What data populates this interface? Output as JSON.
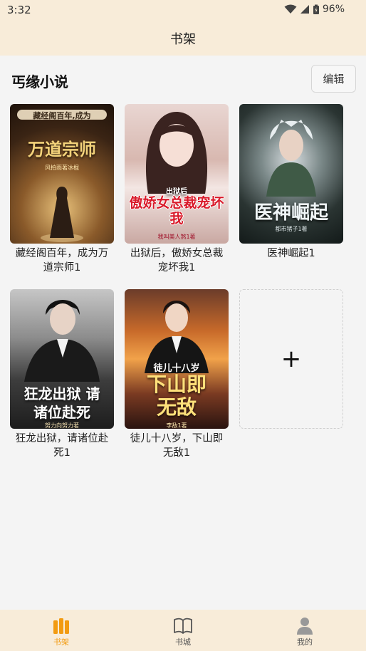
{
  "status": {
    "time": "3:32",
    "battery": "96%"
  },
  "header": {
    "title": "书架"
  },
  "shelf": {
    "name": "丐缘小说",
    "edit_label": "编辑"
  },
  "books": [
    {
      "title": "藏经阁百年，成为万道宗师1",
      "cover_top": "藏经阁百年,成为",
      "cover_main": "万道宗师",
      "cover_author": "风拍雨著冰棍"
    },
    {
      "title": "出狱后，傲娇女总裁宠坏我1",
      "cover_top": "出狱后",
      "cover_main": "傲娇女总裁宠坏我",
      "cover_author": "我叫美人煞1著"
    },
    {
      "title": "医神崛起1",
      "cover_top": "",
      "cover_main": "医神崛起",
      "cover_author": "都市猪子1著"
    },
    {
      "title": "狂龙出狱，请诸位赴死1",
      "cover_top": "",
      "cover_main": "狂龙出狱 请诸位赴死",
      "cover_author": "努力向努力著"
    },
    {
      "title": "徒儿十八岁，下山即无敌1",
      "cover_top": "徒儿十八岁",
      "cover_main": "下山即无敌",
      "cover_author": "李敌1著"
    }
  ],
  "add_button": {
    "label": "+"
  },
  "tabs": [
    {
      "label": "书架",
      "icon": "bookshelf-icon",
      "active": true
    },
    {
      "label": "书城",
      "icon": "book-open-icon",
      "active": false
    },
    {
      "label": "我的",
      "icon": "user-icon",
      "active": false
    }
  ],
  "colors": {
    "accent": "#f29b11",
    "header_bg": "#f8ecd9",
    "tab_inactive": "#555555"
  }
}
